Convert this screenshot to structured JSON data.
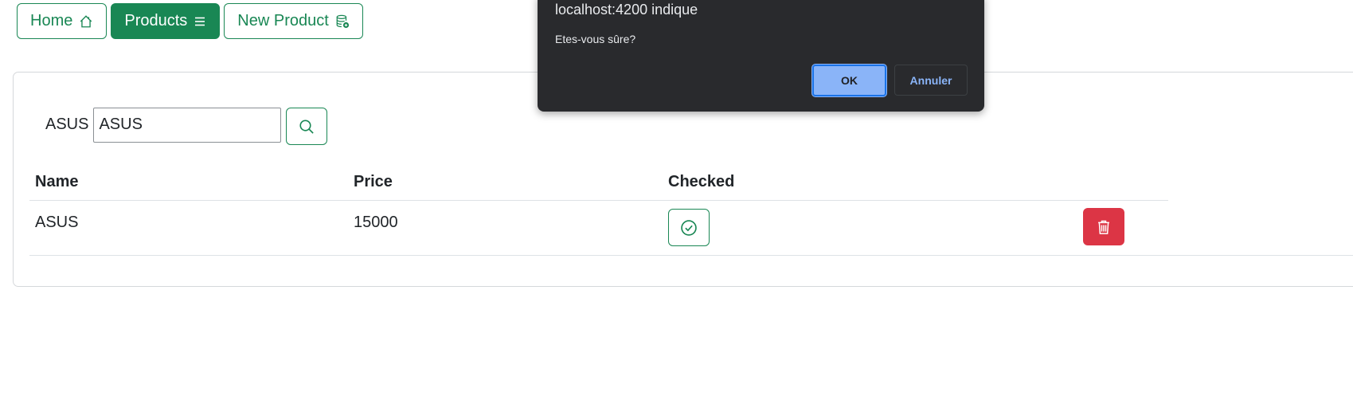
{
  "nav": {
    "home_label": "Home",
    "products_label": "Products",
    "new_product_label": "New Product"
  },
  "search": {
    "label": "ASUS",
    "value": "ASUS"
  },
  "table": {
    "headers": [
      "Name",
      "Price",
      "Checked"
    ],
    "rows": [
      {
        "name": "ASUS",
        "price": "15000",
        "checked": true
      }
    ]
  },
  "dialog": {
    "title": "localhost:4200 indique",
    "message": "Etes-vous sûre?",
    "ok_label": "OK",
    "cancel_label": "Annuler"
  },
  "colors": {
    "success": "#198754",
    "danger": "#dc3545",
    "dialog_bg": "#292a2d",
    "dialog_accent": "#8ab4f8"
  },
  "icons": {
    "home": "house-icon",
    "products": "list-icon",
    "new_product": "database-add-icon",
    "search": "search-icon",
    "check": "check-circle-icon",
    "delete": "trash-icon"
  }
}
